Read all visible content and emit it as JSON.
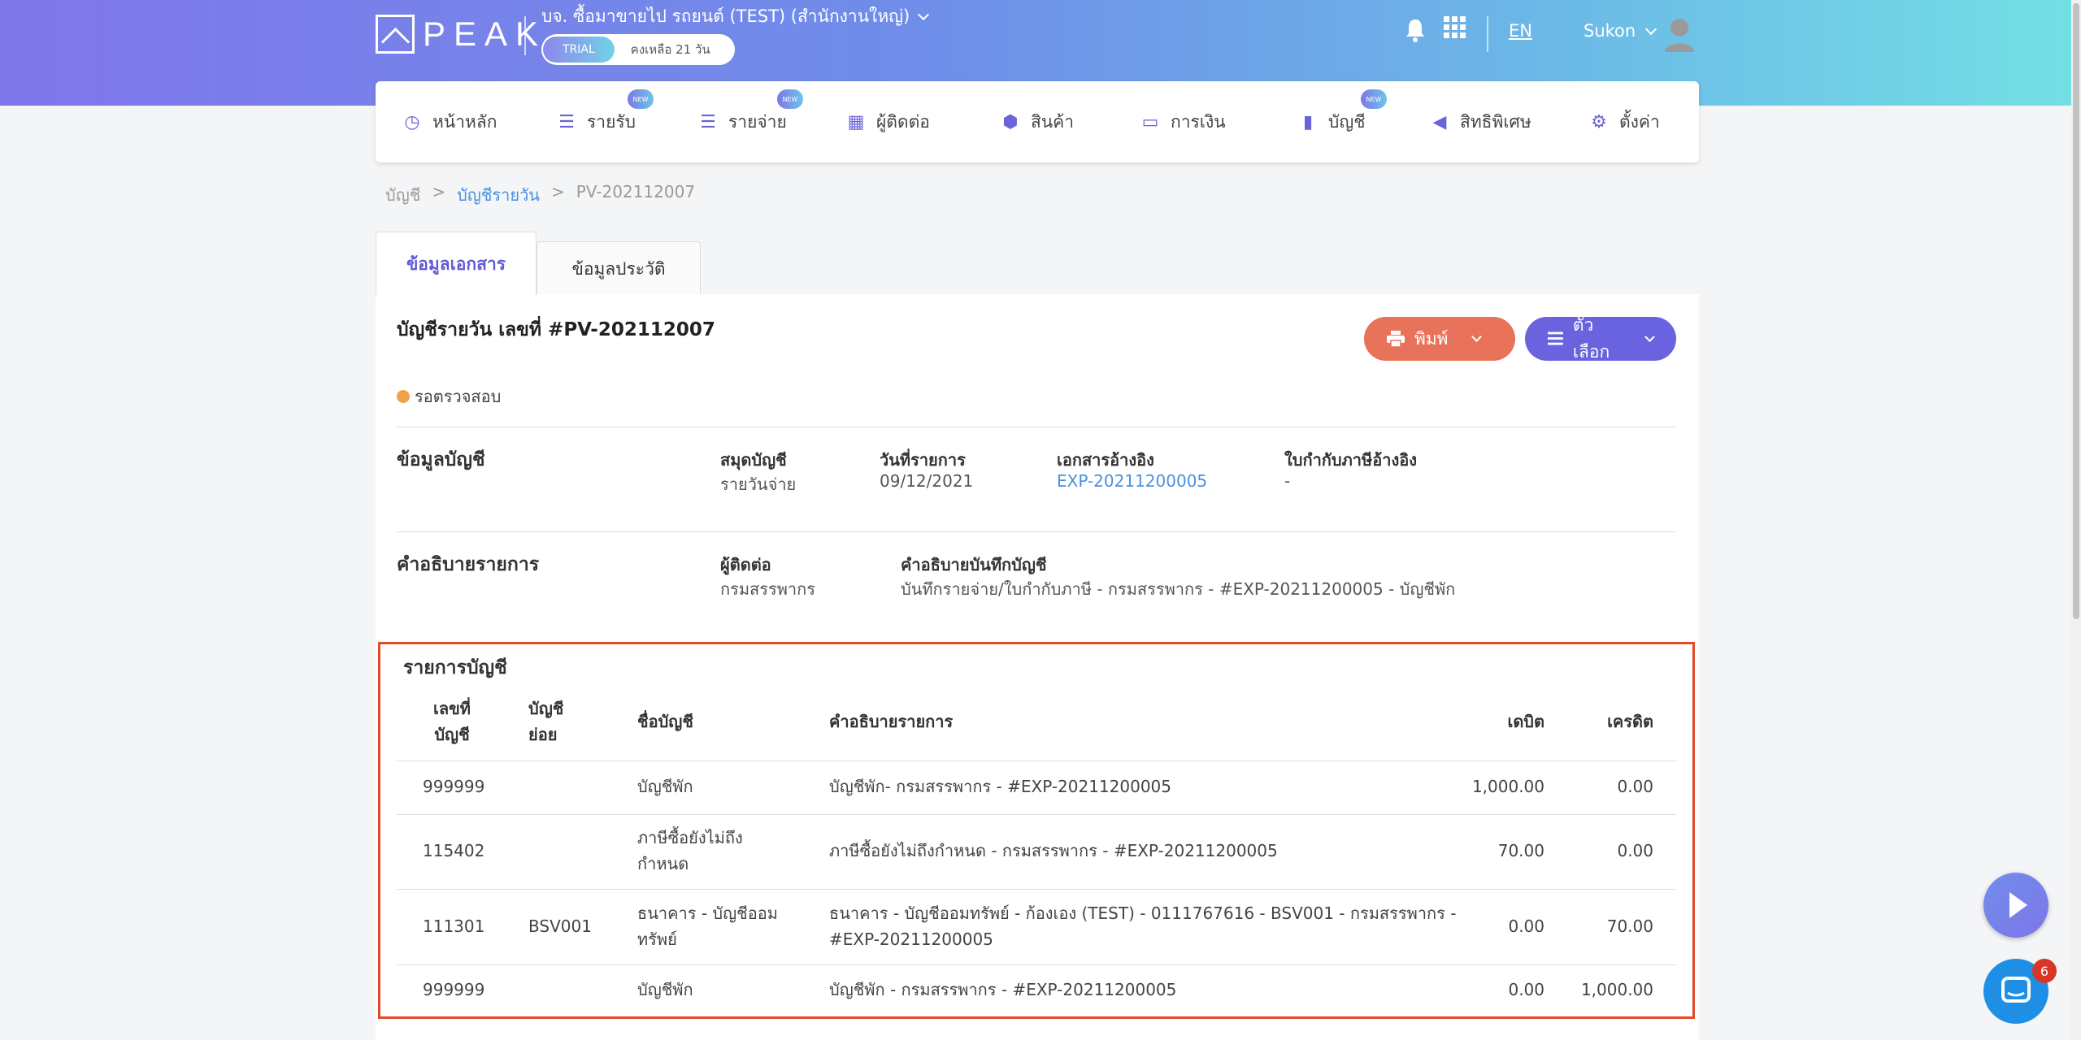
{
  "brand": {
    "logo_text": "PEAK"
  },
  "company": {
    "name": "บจ. ซื้อมาขายไป รถยนต์ (TEST) (สำนักงานใหญ่)",
    "trial_label": "TRIAL",
    "days_left": "คงเหลือ 21 วัน"
  },
  "top": {
    "lang": "EN",
    "user": "Sukon"
  },
  "nav": {
    "items": [
      {
        "label": "หน้าหลัก",
        "icon": "dashboard-icon",
        "glyph": "◷",
        "badge": ""
      },
      {
        "label": "รายรับ",
        "icon": "income-list-icon",
        "glyph": "☰",
        "badge": "NEW"
      },
      {
        "label": "รายจ่าย",
        "icon": "expense-list-icon",
        "glyph": "☰",
        "badge": "NEW"
      },
      {
        "label": "ผู้ติดต่อ",
        "icon": "contacts-icon",
        "glyph": "▦",
        "badge": ""
      },
      {
        "label": "สินค้า",
        "icon": "product-box-icon",
        "glyph": "⬢",
        "badge": ""
      },
      {
        "label": "การเงิน",
        "icon": "money-icon",
        "glyph": "▭",
        "badge": ""
      },
      {
        "label": "บัญชี",
        "icon": "ledger-icon",
        "glyph": "▮",
        "badge": "NEW"
      },
      {
        "label": "สิทธิพิเศษ",
        "icon": "megaphone-icon",
        "glyph": "◀",
        "badge": ""
      },
      {
        "label": "ตั้งค่า",
        "icon": "gear-icon",
        "glyph": "⚙",
        "badge": ""
      }
    ]
  },
  "breadcrumb": {
    "root": "บัญชี",
    "parent": "บัญชีรายวัน",
    "current": "PV-202112007",
    "sep": ">"
  },
  "tabs": {
    "doc_info": "ข้อมูลเอกสาร",
    "history": "ข้อมูลประวัติ"
  },
  "doc": {
    "title": "บัญชีรายวัน เลขที่ #PV-202112007",
    "status": "รอตรวจสอบ",
    "print_label": "พิมพ์",
    "options_label": "ตัวเลือก"
  },
  "account_info": {
    "section_title": "ข้อมูลบัญชี",
    "journal_label": "สมุดบัญชี",
    "journal_value": "รายวันจ่าย",
    "date_label": "วันที่รายการ",
    "date_value": "09/12/2021",
    "ref_label": "เอกสารอ้างอิง",
    "ref_value": "EXP-20211200005",
    "tax_ref_label": "ใบกำกับภาษีอ้างอิง",
    "tax_ref_value": "-"
  },
  "description": {
    "section_title": "คำอธิบายรายการ",
    "contact_label": "ผู้ติดต่อ",
    "contact_value": "กรมสรรพากร",
    "note_label": "คำอธิบายบันทึกบัญชี",
    "note_value": "บันทึกรายจ่าย/ใบกำกับภาษี - กรมสรรพากร - #EXP-20211200005 - บัญชีพัก"
  },
  "ledger": {
    "title": "รายการบัญชี",
    "headers": {
      "acc_no_1": "เลขที่",
      "acc_no_2": "บัญชี",
      "sub_1": "บัญชี",
      "sub_2": "ย่อย",
      "name": "ชื่อบัญชี",
      "desc": "คำอธิบายรายการ",
      "debit": "เดบิต",
      "credit": "เครดิต"
    },
    "rows": [
      {
        "acc_no": "999999",
        "sub": "",
        "name_1": "บัญชีพัก",
        "name_2": "",
        "desc_1": "บัญชีพัก- กรมสรรพากร - #EXP-20211200005",
        "desc_2": "",
        "debit": "1,000.00",
        "credit": "0.00"
      },
      {
        "acc_no": "115402",
        "sub": "",
        "name_1": "ภาษีซื้อยังไม่ถึง",
        "name_2": "กำหนด",
        "desc_1": "ภาษีซื้อยังไม่ถึงกำหนด - กรมสรรพากร - #EXP-20211200005",
        "desc_2": "",
        "debit": "70.00",
        "credit": "0.00"
      },
      {
        "acc_no": "111301",
        "sub": "BSV001",
        "name_1": "ธนาคาร - บัญชีออม",
        "name_2": "ทรัพย์",
        "desc_1": "ธนาคาร - บัญชีออมทรัพย์ - ก้องเอง (TEST) - 0111767616 - BSV001 - กรมสรรพากร -",
        "desc_2": "#EXP-20211200005",
        "debit": "0.00",
        "credit": "70.00"
      },
      {
        "acc_no": "999999",
        "sub": "",
        "name_1": "บัญชีพัก",
        "name_2": "",
        "desc_1": "บัญชีพัก - กรมสรรพากร - #EXP-20211200005",
        "desc_2": "",
        "debit": "0.00",
        "credit": "1,000.00"
      }
    ]
  },
  "chat": {
    "badge": "6"
  },
  "colors": {
    "accent": "#6a63df",
    "print": "#e8735a",
    "status_dot": "#f0a24b",
    "link": "#4a90e2",
    "highlight": "#e34a2a"
  }
}
